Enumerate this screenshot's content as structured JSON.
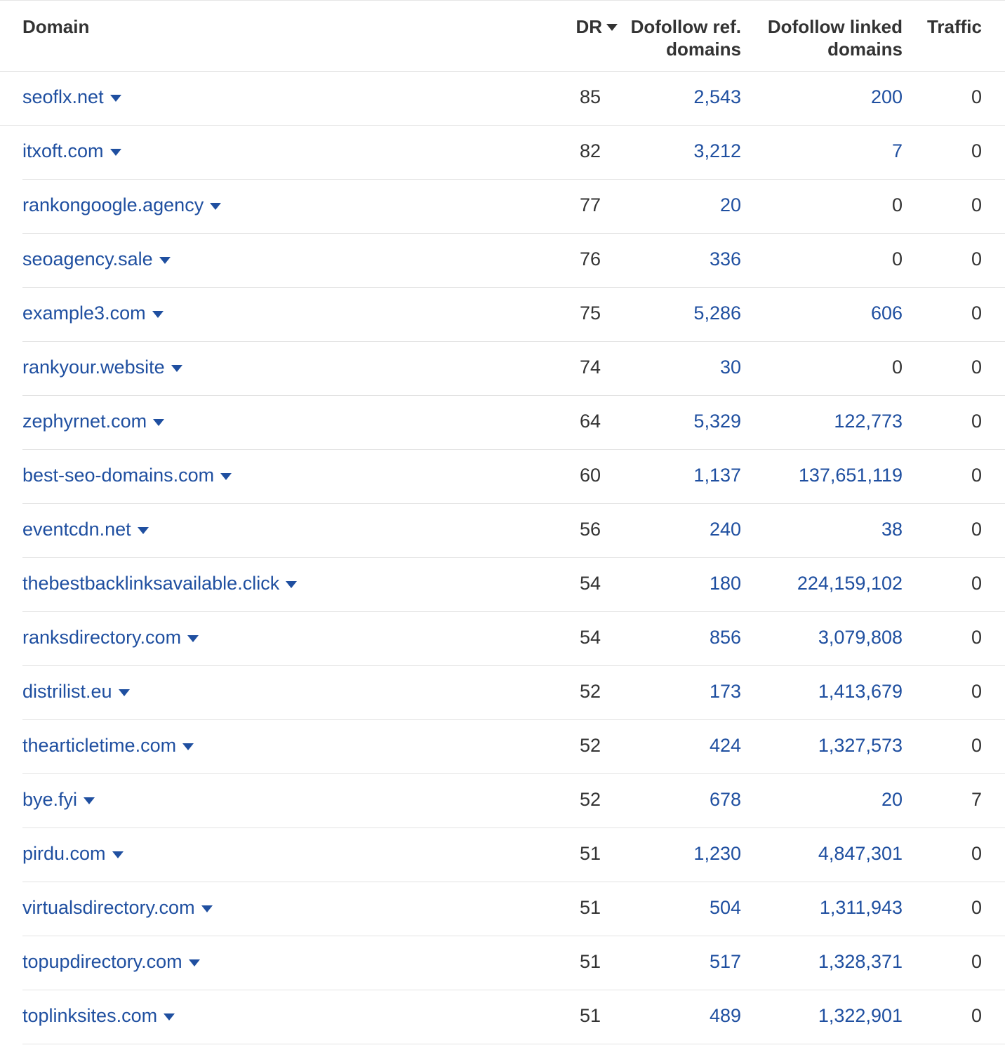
{
  "headers": {
    "domain": "Domain",
    "dr": "DR",
    "ref_line1": "Dofollow ref.",
    "ref_line2": "domains",
    "linked_line1": "Dofollow linked",
    "linked_line2": "domains",
    "traffic": "Traffic"
  },
  "sort_indicator_icon": "caret-down-icon",
  "colors": {
    "link": "#1f4fa0",
    "text": "#333333",
    "divider": "#e3e3e3"
  },
  "rows": [
    {
      "domain": "seoflx.net",
      "dr": "85",
      "ref": "2,543",
      "linked": "200",
      "traffic": "0"
    },
    {
      "domain": "itxoft.com",
      "dr": "82",
      "ref": "3,212",
      "linked": "7",
      "traffic": "0"
    },
    {
      "domain": "rankongoogle.agency",
      "dr": "77",
      "ref": "20",
      "linked": "0",
      "traffic": "0"
    },
    {
      "domain": "seoagency.sale",
      "dr": "76",
      "ref": "336",
      "linked": "0",
      "traffic": "0"
    },
    {
      "domain": "example3.com",
      "dr": "75",
      "ref": "5,286",
      "linked": "606",
      "traffic": "0"
    },
    {
      "domain": "rankyour.website",
      "dr": "74",
      "ref": "30",
      "linked": "0",
      "traffic": "0"
    },
    {
      "domain": "zephyrnet.com",
      "dr": "64",
      "ref": "5,329",
      "linked": "122,773",
      "traffic": "0"
    },
    {
      "domain": "best-seo-domains.com",
      "dr": "60",
      "ref": "1,137",
      "linked": "137,651,119",
      "traffic": "0"
    },
    {
      "domain": "eventcdn.net",
      "dr": "56",
      "ref": "240",
      "linked": "38",
      "traffic": "0"
    },
    {
      "domain": "thebestbacklinksavailable.click",
      "dr": "54",
      "ref": "180",
      "linked": "224,159,102",
      "traffic": "0"
    },
    {
      "domain": "ranksdirectory.com",
      "dr": "54",
      "ref": "856",
      "linked": "3,079,808",
      "traffic": "0"
    },
    {
      "domain": "distrilist.eu",
      "dr": "52",
      "ref": "173",
      "linked": "1,413,679",
      "traffic": "0"
    },
    {
      "domain": "thearticletime.com",
      "dr": "52",
      "ref": "424",
      "linked": "1,327,573",
      "traffic": "0"
    },
    {
      "domain": "bye.fyi",
      "dr": "52",
      "ref": "678",
      "linked": "20",
      "traffic": "7"
    },
    {
      "domain": "pirdu.com",
      "dr": "51",
      "ref": "1,230",
      "linked": "4,847,301",
      "traffic": "0"
    },
    {
      "domain": "virtualsdirectory.com",
      "dr": "51",
      "ref": "504",
      "linked": "1,311,943",
      "traffic": "0"
    },
    {
      "domain": "topupdirectory.com",
      "dr": "51",
      "ref": "517",
      "linked": "1,328,371",
      "traffic": "0"
    },
    {
      "domain": "toplinksites.com",
      "dr": "51",
      "ref": "489",
      "linked": "1,322,901",
      "traffic": "0"
    }
  ]
}
